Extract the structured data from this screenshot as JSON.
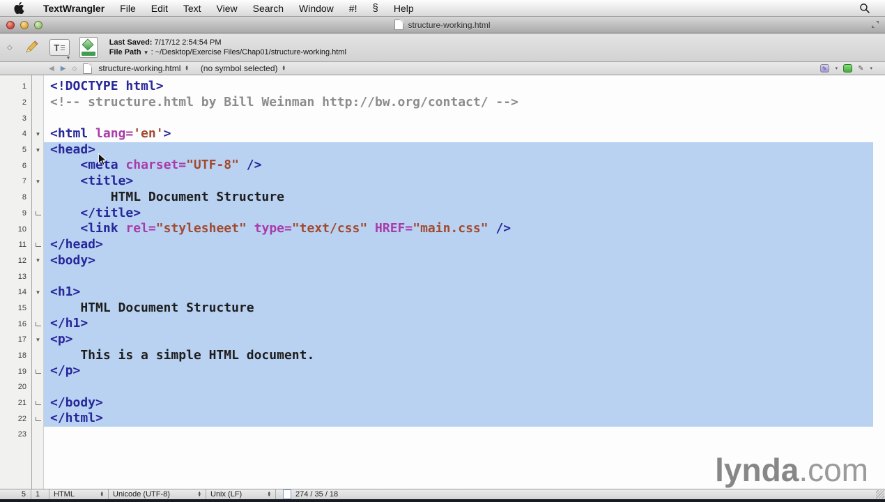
{
  "window": {
    "title": "structure-working.html"
  },
  "menu_bar": {
    "items": [
      {
        "label": "TextWrangler",
        "bold": true
      },
      {
        "label": "File"
      },
      {
        "label": "Edit"
      },
      {
        "label": "Text"
      },
      {
        "label": "View"
      },
      {
        "label": "Search"
      },
      {
        "label": "Window"
      },
      {
        "label": "#!"
      },
      {
        "icon": "scripts-menu-icon",
        "glyph": "§"
      },
      {
        "label": "Help"
      }
    ]
  },
  "toolbar": {
    "last_saved_label": "Last Saved:",
    "last_saved_value": "7/17/12 2:54:54 PM",
    "file_path_label": "File Path",
    "file_path_separator": ":",
    "file_path_value": "~/Desktop/Exercise Files/Chap01/structure-working.html"
  },
  "nav_bar": {
    "filename": "structure-working.html",
    "symbol_selector": "(no symbol selected)"
  },
  "editor": {
    "lines": [
      {
        "n": 1,
        "fold": null,
        "sel": false,
        "tokens": [
          {
            "c": "tag",
            "t": "<!DOCTYPE html>"
          }
        ]
      },
      {
        "n": 2,
        "fold": null,
        "sel": false,
        "tokens": [
          {
            "c": "com",
            "t": "<!-- structure.html by Bill Weinman http://bw.org/contact/ -->"
          }
        ]
      },
      {
        "n": 3,
        "fold": null,
        "sel": false,
        "tokens": []
      },
      {
        "n": 4,
        "fold": "start",
        "sel": false,
        "tokens": [
          {
            "c": "tag",
            "t": "<html "
          },
          {
            "c": "attr",
            "t": "lang="
          },
          {
            "c": "val",
            "t": "'en'"
          },
          {
            "c": "tag",
            "t": ">"
          }
        ]
      },
      {
        "n": 5,
        "fold": "start",
        "sel": true,
        "tokens": [
          {
            "c": "tag",
            "t": "<head>"
          }
        ]
      },
      {
        "n": 6,
        "fold": null,
        "sel": true,
        "tokens": [
          {
            "c": "txt",
            "t": "    "
          },
          {
            "c": "tag",
            "t": "<meta "
          },
          {
            "c": "attr",
            "t": "charset="
          },
          {
            "c": "val",
            "t": "\"UTF-8\""
          },
          {
            "c": "tag",
            "t": " />"
          }
        ]
      },
      {
        "n": 7,
        "fold": "start",
        "sel": true,
        "tokens": [
          {
            "c": "txt",
            "t": "    "
          },
          {
            "c": "tag",
            "t": "<title>"
          }
        ]
      },
      {
        "n": 8,
        "fold": null,
        "sel": true,
        "tokens": [
          {
            "c": "txt",
            "t": "        HTML Document Structure"
          }
        ]
      },
      {
        "n": 9,
        "fold": "end",
        "sel": true,
        "tokens": [
          {
            "c": "txt",
            "t": "    "
          },
          {
            "c": "tag",
            "t": "</title>"
          }
        ]
      },
      {
        "n": 10,
        "fold": null,
        "sel": true,
        "tokens": [
          {
            "c": "txt",
            "t": "    "
          },
          {
            "c": "tag",
            "t": "<link "
          },
          {
            "c": "attr",
            "t": "rel="
          },
          {
            "c": "val",
            "t": "\"stylesheet\""
          },
          {
            "c": "txt",
            "t": " "
          },
          {
            "c": "attr",
            "t": "type="
          },
          {
            "c": "val",
            "t": "\"text/css\""
          },
          {
            "c": "txt",
            "t": " "
          },
          {
            "c": "attr",
            "t": "HREF="
          },
          {
            "c": "val",
            "t": "\"main.css\""
          },
          {
            "c": "tag",
            "t": " />"
          }
        ]
      },
      {
        "n": 11,
        "fold": "end",
        "sel": true,
        "tokens": [
          {
            "c": "tag",
            "t": "</head>"
          }
        ]
      },
      {
        "n": 12,
        "fold": "start",
        "sel": true,
        "tokens": [
          {
            "c": "tag",
            "t": "<body>"
          }
        ]
      },
      {
        "n": 13,
        "fold": null,
        "sel": true,
        "tokens": []
      },
      {
        "n": 14,
        "fold": "start",
        "sel": true,
        "tokens": [
          {
            "c": "tag",
            "t": "<h1>"
          }
        ]
      },
      {
        "n": 15,
        "fold": null,
        "sel": true,
        "tokens": [
          {
            "c": "txt",
            "t": "    HTML Document Structure"
          }
        ]
      },
      {
        "n": 16,
        "fold": "end",
        "sel": true,
        "tokens": [
          {
            "c": "tag",
            "t": "</h1>"
          }
        ]
      },
      {
        "n": 17,
        "fold": "start",
        "sel": true,
        "tokens": [
          {
            "c": "tag",
            "t": "<p>"
          }
        ]
      },
      {
        "n": 18,
        "fold": null,
        "sel": true,
        "tokens": [
          {
            "c": "txt",
            "t": "    This is a simple HTML document."
          }
        ]
      },
      {
        "n": 19,
        "fold": "end",
        "sel": true,
        "tokens": [
          {
            "c": "tag",
            "t": "</p>"
          }
        ]
      },
      {
        "n": 20,
        "fold": null,
        "sel": true,
        "tokens": []
      },
      {
        "n": 21,
        "fold": "end",
        "sel": true,
        "tokens": [
          {
            "c": "tag",
            "t": "</body>"
          }
        ]
      },
      {
        "n": 22,
        "fold": "end",
        "sel": true,
        "tokens": [
          {
            "c": "tag",
            "t": "</html>"
          }
        ]
      },
      {
        "n": 23,
        "fold": null,
        "sel": false,
        "tokens": []
      }
    ]
  },
  "status_bar": {
    "cursor_line": "5",
    "cursor_column": "1",
    "language": "HTML",
    "encoding": "Unicode (UTF-8)",
    "line_endings": "Unix (LF)",
    "stats": "274 / 35 / 18"
  },
  "watermark": {
    "bold": "lynda",
    "rest": ".com"
  },
  "colors": {
    "selection": "#b9d2f2",
    "tag": "#26269a",
    "attr": "#a93ba9",
    "value": "#a14a30",
    "comment": "#8c8c8c",
    "code_text": "#1d1d1d"
  }
}
